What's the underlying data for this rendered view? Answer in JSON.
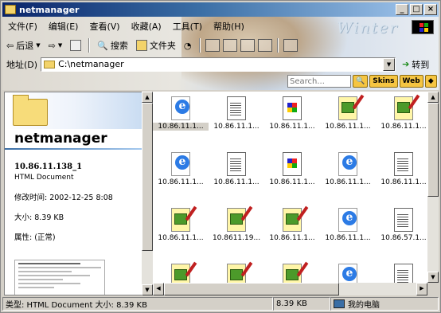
{
  "window": {
    "title": "netmanager",
    "minimize": "_",
    "maximize": "□",
    "close": "×"
  },
  "banner": {
    "watermark": "Winter"
  },
  "menu": [
    {
      "label": "文件(F)"
    },
    {
      "label": "编辑(E)"
    },
    {
      "label": "查看(V)"
    },
    {
      "label": "收藏(A)"
    },
    {
      "label": "工具(T)"
    },
    {
      "label": "帮助(H)"
    }
  ],
  "toolbar": {
    "back": "后退",
    "search": "搜索",
    "folders": "文件夹"
  },
  "address": {
    "label": "地址(D)",
    "value": "C:\\netmanager",
    "go": "转到"
  },
  "searchbar": {
    "placeholder": "Search...",
    "skins": "Skins",
    "web": "Web"
  },
  "leftpanel": {
    "folder_title": "netmanager",
    "filename": "10.86.11.138_1",
    "filetype": "HTML Document",
    "modified": "修改时间: 2002-12-25 8:08",
    "size": "大小: 8.39 KB",
    "attributes": "属性: (正常)"
  },
  "files": [
    {
      "name": "10.86.11.1...",
      "icon": "ie-html-icon",
      "selected": true
    },
    {
      "name": "10.86.11.1...",
      "icon": "text-document-icon"
    },
    {
      "name": "10.86.11.1...",
      "icon": "windows-file-icon"
    },
    {
      "name": "10.86.11.1...",
      "icon": "certificate-icon"
    },
    {
      "name": "10.86.11.1...",
      "icon": "certificate-icon"
    },
    {
      "name": "10.86.11.1...",
      "icon": "ie-html-icon"
    },
    {
      "name": "10.86.11.1...",
      "icon": "text-document-icon"
    },
    {
      "name": "10.86.11.1...",
      "icon": "windows-file-icon"
    },
    {
      "name": "10.86.11.1...",
      "icon": "ie-html-icon"
    },
    {
      "name": "10.86.11.1...",
      "icon": "text-document-icon"
    },
    {
      "name": "10.86.11.1...",
      "icon": "certificate-icon"
    },
    {
      "name": "10.8611.19...",
      "icon": "certificate-icon"
    },
    {
      "name": "10.86.11.1...",
      "icon": "certificate-icon"
    },
    {
      "name": "10.86.11.1...",
      "icon": "ie-html-icon"
    },
    {
      "name": "10.86.57.1...",
      "icon": "text-document-icon"
    },
    {
      "name": "",
      "icon": "certificate-icon"
    },
    {
      "name": "",
      "icon": "certificate-icon"
    },
    {
      "name": "",
      "icon": "certificate-icon"
    },
    {
      "name": "",
      "icon": "ie-html-icon"
    },
    {
      "name": "",
      "icon": "text-document-icon"
    }
  ],
  "statusbar": {
    "info": "类型: HTML Document 大小: 8.39 KB",
    "size": "8.39 KB",
    "zone": "我的电脑"
  }
}
